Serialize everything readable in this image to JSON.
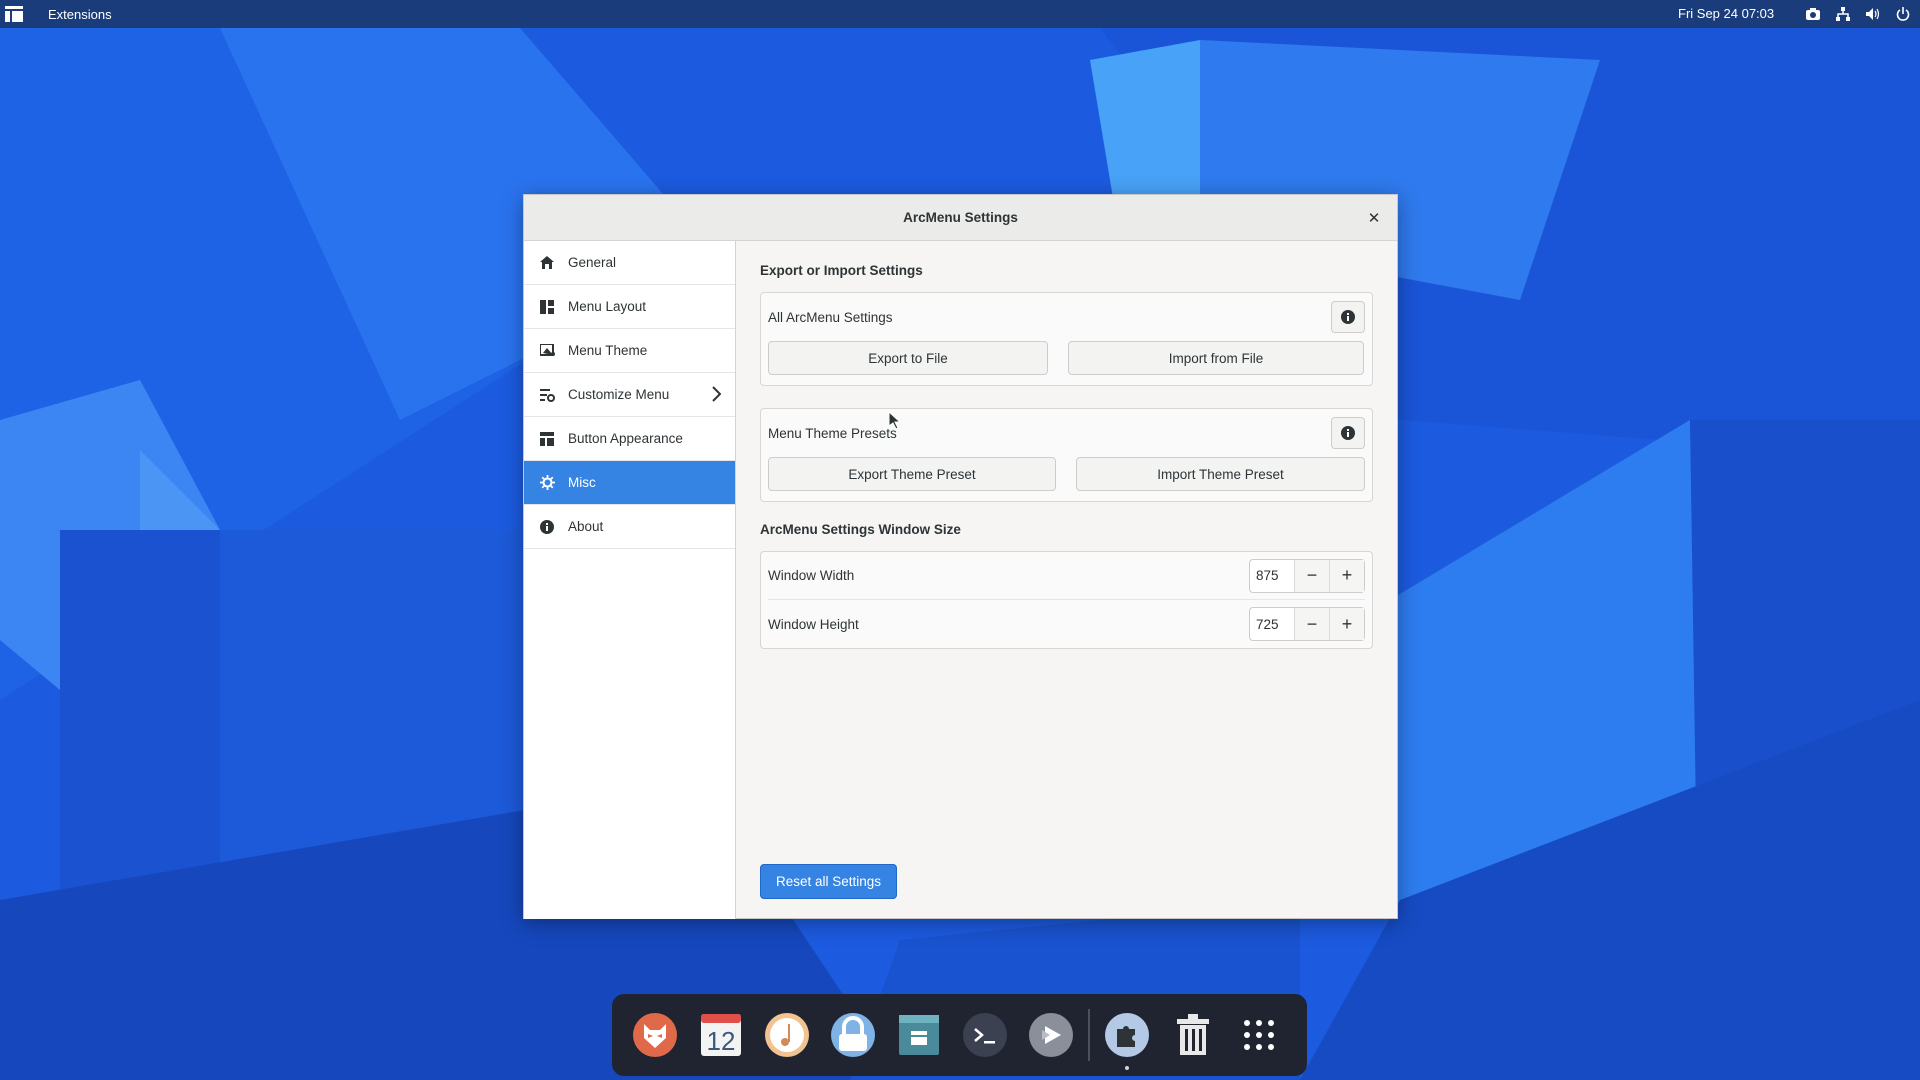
{
  "topbar": {
    "app_title": "Extensions",
    "clock": "Fri Sep 24  07:03",
    "tray": [
      "screenshot-icon",
      "network-icon",
      "volume-icon",
      "power-icon"
    ]
  },
  "window": {
    "title": "ArcMenu Settings",
    "sidebar": {
      "items": [
        {
          "label": "General",
          "icon": "home-icon"
        },
        {
          "label": "Menu Layout",
          "icon": "layout-icon"
        },
        {
          "label": "Menu Theme",
          "icon": "theme-icon"
        },
        {
          "label": "Customize Menu",
          "icon": "customize-icon"
        },
        {
          "label": "Button Appearance",
          "icon": "button-appearance-icon"
        },
        {
          "label": "Misc",
          "icon": "misc-icon",
          "active": true
        },
        {
          "label": "About",
          "icon": "info-icon"
        }
      ]
    },
    "content": {
      "export_section_title": "Export or Import Settings",
      "all_settings": {
        "label": "All ArcMenu Settings",
        "export_label": "Export to File",
        "import_label": "Import from File"
      },
      "theme_presets": {
        "label": "Menu Theme Presets",
        "export_label": "Export Theme Preset",
        "import_label": "Import Theme Preset"
      },
      "window_size_title": "ArcMenu Settings Window Size",
      "window_width": {
        "label": "Window Width",
        "value": "875"
      },
      "window_height": {
        "label": "Window Height",
        "value": "725"
      },
      "minus": "−",
      "plus": "+",
      "reset_label": "Reset all Settings"
    }
  },
  "dock": {
    "items": [
      "firefox-icon",
      "calendar-icon",
      "music-icon",
      "lock-icon",
      "software-store-icon",
      "terminal-icon",
      "video-icon",
      "extensions-icon",
      "trash-icon",
      "app-grid-icon"
    ],
    "calendar_day": "12"
  },
  "colors": {
    "accent": "#3584e4",
    "topbar": "#1b3c7a",
    "wallpaper": "#1a56d6"
  }
}
